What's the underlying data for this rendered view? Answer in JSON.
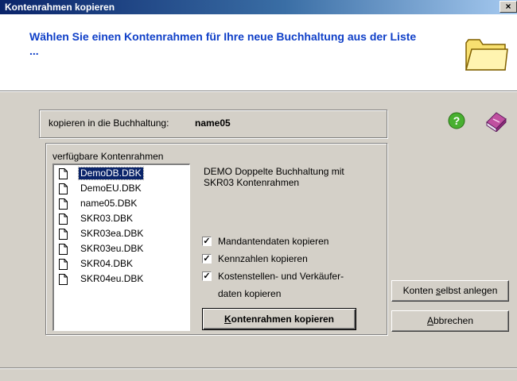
{
  "window": {
    "title": "Kontenrahmen kopieren",
    "close_glyph": "×"
  },
  "header": {
    "title": "Wählen Sie einen Kontenrahmen für Ihre neue Buchhaltung aus der Liste ...",
    "icon": "folder-icon"
  },
  "target": {
    "label": "kopieren in die Buchhaltung:",
    "value": "name05"
  },
  "icons": {
    "help": "help-icon",
    "book": "book-icon"
  },
  "list": {
    "caption": "verfügbare Kontenrahmen",
    "items": [
      "DemoDB.DBK",
      "DemoEU.DBK",
      "name05.DBK",
      "SKR03.DBK",
      "SKR03ea.DBK",
      "SKR03eu.DBK",
      "SKR04.DBK",
      "SKR04eu.DBK"
    ],
    "selected": "DemoDB.DBK"
  },
  "description": {
    "line1": "DEMO Doppelte Buchhaltung mit",
    "line2": "SKR03 Kontenrahmen"
  },
  "options": {
    "mandanten": {
      "label": "Mandantendaten kopieren",
      "checked": true
    },
    "kennzahlen": {
      "label": "Kennzahlen kopieren",
      "checked": true
    },
    "kostenstellen": {
      "label_line1": "Kostenstellen- und Verkäufer-",
      "label_line2": "daten kopieren",
      "checked": true
    }
  },
  "buttons": {
    "copy": {
      "accel": "K",
      "rest": "ontenrahmen kopieren"
    },
    "self_create": {
      "pre": "Konten ",
      "accel": "s",
      "rest": "elbst anlegen"
    },
    "cancel": {
      "accel": "A",
      "rest": "bbrechen"
    }
  },
  "colors": {
    "title_bar": "#0a246a",
    "header_text": "#1040c8",
    "selection": "#0a246a",
    "dialog_bg": "#d4d0c8"
  }
}
